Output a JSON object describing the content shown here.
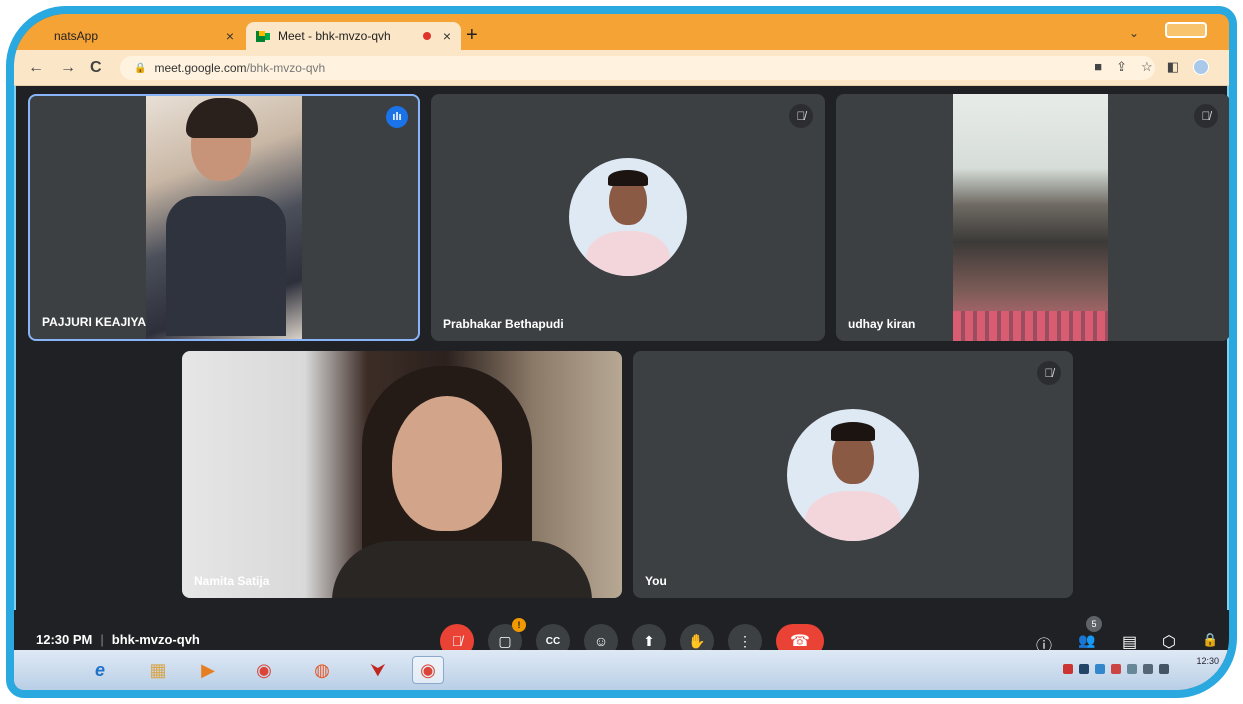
{
  "browser": {
    "tabs": [
      {
        "title": "natsApp",
        "close": "×"
      },
      {
        "title": "Meet - bhk-mvzo-qvh",
        "close": "×"
      }
    ],
    "new_tab": "+",
    "tab_menu": "⌄",
    "nav": {
      "back": "←",
      "forward": "→",
      "reload": "C"
    },
    "url_host": "meet.google.com",
    "url_path": "/bhk-mvzo-qvh",
    "lock": "🔒",
    "toolbar_icons": {
      "cast": "■",
      "share": "⇪",
      "bookmark": "☆",
      "sidepanel": "◧"
    }
  },
  "tiles": [
    {
      "name": "PAJJURI KEAJIYA",
      "speaking": "ılı"
    },
    {
      "name": "Prabhakar Bethapudi",
      "muted": "🎙̸"
    },
    {
      "name": "udhay kiran",
      "muted": "🎙̸"
    },
    {
      "name": "Namita Satija"
    },
    {
      "name": "You",
      "muted": "🎙̸"
    }
  ],
  "bottom": {
    "time": "12:30 PM",
    "separator": "|",
    "meeting_code": "bhk-mvzo-qvh",
    "controls": {
      "mic": "🎙̸",
      "camera": "▢",
      "camera_badge": "!",
      "captions": "CC",
      "emoji": "☺",
      "present": "⬆",
      "hand": "✋",
      "more": "⋮",
      "leave": "☎"
    },
    "right_icons": {
      "info": "ⓘ",
      "people": "👥",
      "chat": "▤",
      "activities": "⬡",
      "host": "🔒"
    },
    "participant_count": "5"
  },
  "taskbar": {
    "apps": [
      "e",
      "▦",
      "▶",
      "◉",
      "◍",
      "⮟",
      "◉"
    ],
    "clock": "12:30"
  },
  "colors": {
    "frame": "#29a9e0",
    "meet_bg": "#202124",
    "tile_bg": "#3c4043",
    "danger": "#ea4335",
    "accent": "#1a73e8"
  }
}
